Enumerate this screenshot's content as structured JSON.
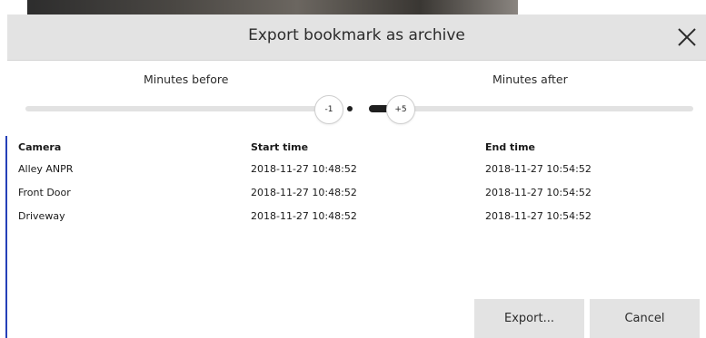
{
  "dialog": {
    "title": "Export bookmark as archive"
  },
  "sliders": {
    "before_label": "Minutes before",
    "after_label": "Minutes after",
    "before_value": "-1",
    "after_value": "+5"
  },
  "table": {
    "headers": {
      "camera": "Camera",
      "start": "Start time",
      "end": "End time"
    },
    "rows": [
      {
        "camera": "Alley ANPR",
        "start": "2018-11-27 10:48:52",
        "end": "2018-11-27 10:54:52"
      },
      {
        "camera": "Front Door",
        "start": "2018-11-27 10:48:52",
        "end": "2018-11-27 10:54:52"
      },
      {
        "camera": "Driveway",
        "start": "2018-11-27 10:48:52",
        "end": "2018-11-27 10:54:52"
      }
    ]
  },
  "buttons": {
    "export": "Export...",
    "cancel": "Cancel"
  },
  "colors": {
    "header_bg": "#e3e3e3",
    "button_bg": "#e3e3e3",
    "accent_blue": "#2540b8",
    "track": "#e2e2e2",
    "track_active": "#1f1f1f"
  },
  "icons": {
    "close": "close-icon"
  }
}
